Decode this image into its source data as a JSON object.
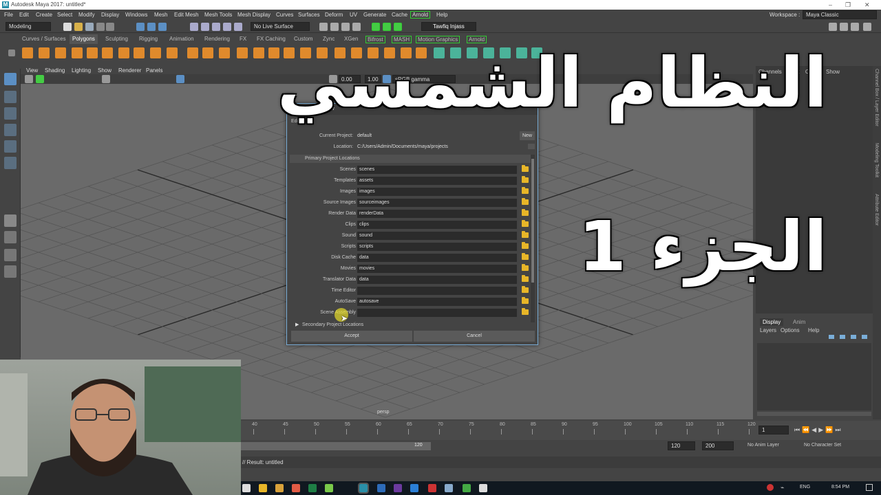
{
  "window": {
    "title": "Autodesk Maya 2017: untitled*"
  },
  "menubar": {
    "items": [
      "File",
      "Edit",
      "Create",
      "Select",
      "Modify",
      "Display",
      "Windows",
      "Mesh",
      "Edit Mesh",
      "Mesh Tools",
      "Mesh Display",
      "Curves",
      "Surfaces",
      "Deform",
      "UV",
      "Generate",
      "Cache",
      "Arnold",
      "Help"
    ],
    "workspace_label": "Workspace :",
    "workspace_value": "Maya Classic"
  },
  "statusline": {
    "mode": "Modeling",
    "live_surface": "No Live Surface",
    "user": "Tawfiq Injass"
  },
  "shelf_tabs": [
    "Curves / Surfaces",
    "Polygons",
    "Sculpting",
    "Rigging",
    "Animation",
    "Rendering",
    "FX",
    "FX Caching",
    "Custom",
    "Zync",
    "XGen",
    "Bifrost",
    "MASH",
    "Motion Graphics",
    "Arnold"
  ],
  "shelf_active": "Polygons",
  "panel_menu": [
    "View",
    "Shading",
    "Lighting",
    "Show",
    "Renderer",
    "Panels"
  ],
  "panel_toolbar": {
    "exposure": "0.00",
    "gamma": "1.00",
    "colorspace": "sRGB gamma"
  },
  "viewport": {
    "camera": "persp"
  },
  "channel_box": {
    "tabs": [
      "Channels",
      "Edit",
      "Object",
      "Show"
    ]
  },
  "layer_editor": {
    "tabs": [
      "Display",
      "Anim"
    ],
    "menus": [
      "Layers",
      "Options",
      "Help"
    ]
  },
  "side_tabs": [
    "Channel Box / Layer Editor",
    "Modeling Toolkit",
    "Attribute Editor"
  ],
  "dialog": {
    "title": "Project Window",
    "menu": "Edit",
    "current_project_label": "Current Project:",
    "current_project": "default",
    "new_button": "New",
    "location_label": "Location:",
    "location": "C:/Users/Admin/Documents/maya/projects",
    "primary_section": "Primary Project Locations",
    "secondary_section": "Secondary Project Locations",
    "rows": [
      {
        "label": "Scenes",
        "value": "scenes"
      },
      {
        "label": "Templates",
        "value": "assets"
      },
      {
        "label": "Images",
        "value": "images"
      },
      {
        "label": "Source Images",
        "value": "sourceimages"
      },
      {
        "label": "Render Data",
        "value": "renderData"
      },
      {
        "label": "Clips",
        "value": "clips"
      },
      {
        "label": "Sound",
        "value": "sound"
      },
      {
        "label": "Scripts",
        "value": "scripts"
      },
      {
        "label": "Disk Cache",
        "value": "data"
      },
      {
        "label": "Movies",
        "value": "movies"
      },
      {
        "label": "Translator Data",
        "value": "data"
      },
      {
        "label": "Time Editor",
        "value": ""
      },
      {
        "label": "AutoSave",
        "value": "autosave"
      },
      {
        "label": "Scene Assembly",
        "value": ""
      }
    ],
    "accept": "Accept",
    "cancel": "Cancel"
  },
  "overlay": {
    "line1": "النظام الشمسي",
    "line2": "الجزء 1"
  },
  "timeslider": {
    "ticks": [
      "40",
      "45",
      "50",
      "55",
      "60",
      "65",
      "70",
      "75",
      "80",
      "85",
      "90",
      "95",
      "100",
      "105",
      "110",
      "115",
      "120"
    ],
    "current_frame": "1"
  },
  "range": {
    "end_handle": "120",
    "anim_end": "120",
    "playback_end": "200",
    "anim_layer": "No Anim Layer",
    "char_set": "No Character Set"
  },
  "command_line": {
    "result": "// Result: untitled"
  },
  "taskbar": {
    "lang": "ENG",
    "time": "8:54 PM"
  },
  "colors": {
    "accent_blue": "#7aaed8",
    "folder": "#e8b628",
    "arnold_green": "#33cc33"
  }
}
